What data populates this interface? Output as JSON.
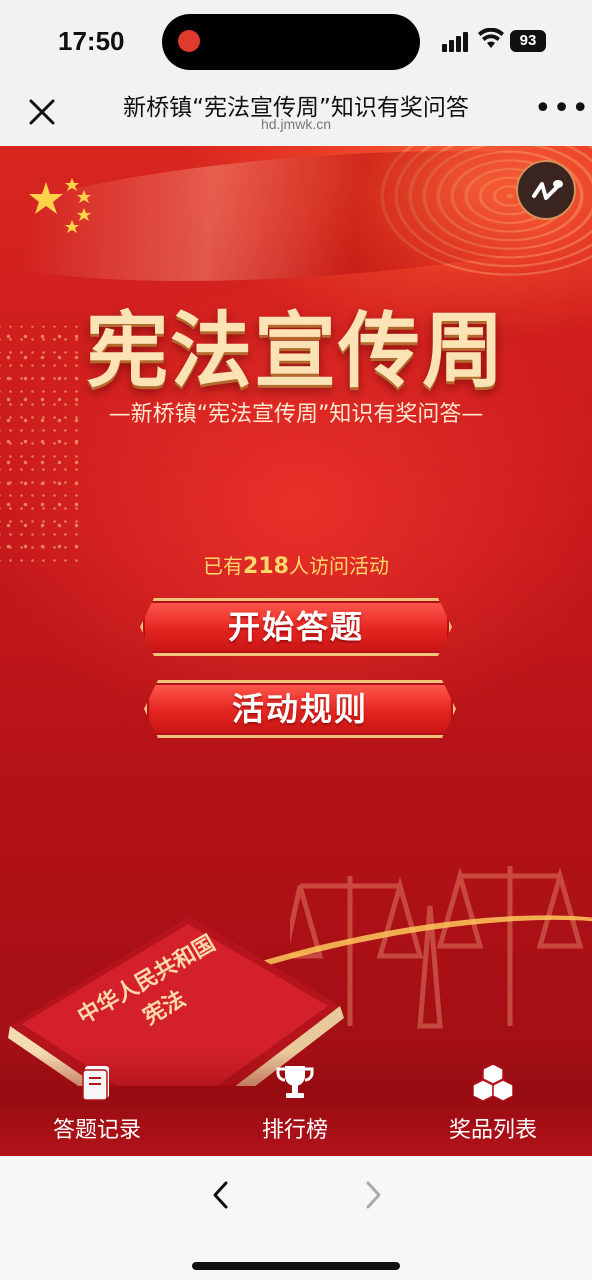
{
  "status_bar": {
    "time": "17:50",
    "battery": "93"
  },
  "nav": {
    "title": "新桥镇“宪法宣传周”知识有奖问答",
    "domain": "hd.jmwk.cn",
    "more": "•••"
  },
  "poster": {
    "main_title": "宪法宣传周",
    "sub_title": "—新桥镇“宪法宣传周”知识有奖问答—",
    "visit_prefix": "已有",
    "visit_count": "218",
    "visit_suffix": "人访问活动",
    "start_button": "开始答题",
    "rules_button": "活动规则",
    "book_title_line1": "中华人民共和国",
    "book_title_line2": "宪法"
  },
  "tabs": [
    {
      "label": "答题记录",
      "icon": "book-icon"
    },
    {
      "label": "排行榜",
      "icon": "trophy-icon"
    },
    {
      "label": "奖品列表",
      "icon": "boxes-icon"
    }
  ],
  "colors": {
    "poster_red": "#c8191b",
    "title_gold": "#fbe3b6",
    "button_border": "#f0c27a",
    "count_yellow": "#ffd86a"
  }
}
